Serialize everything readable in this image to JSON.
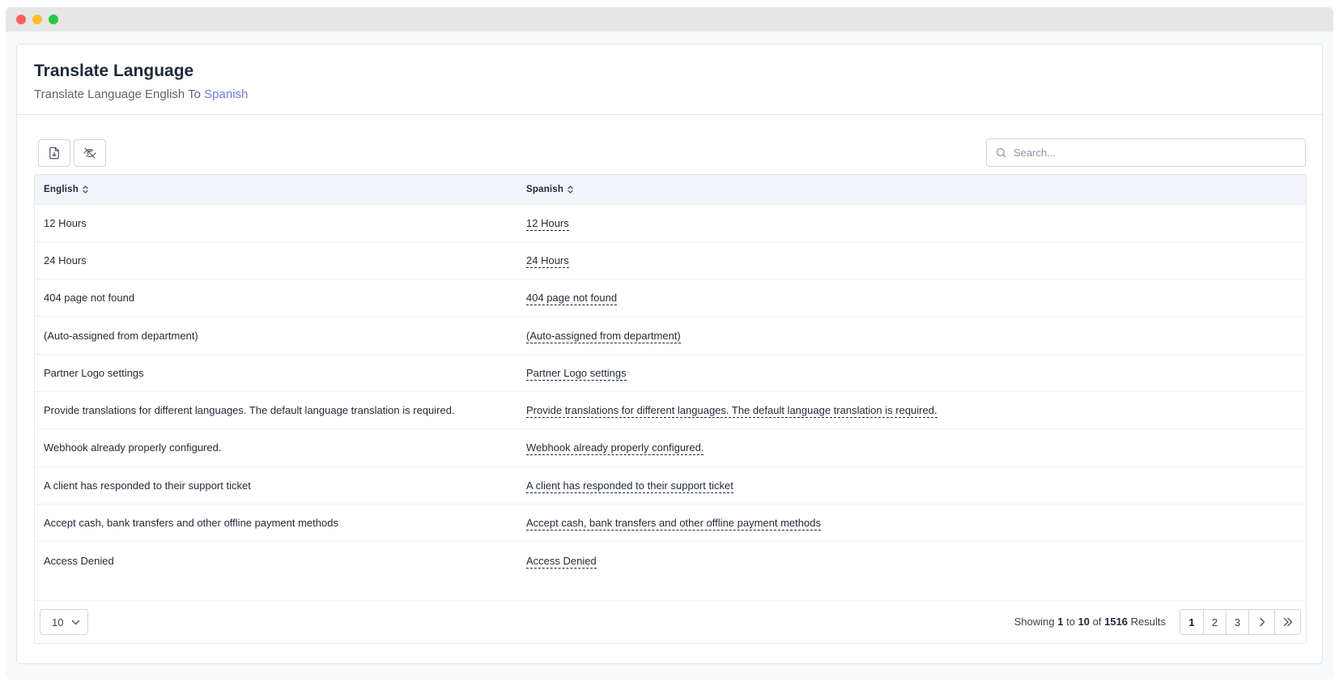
{
  "window": {
    "controls": [
      "close",
      "minimize",
      "maximize"
    ]
  },
  "header": {
    "title": "Translate Language",
    "subtitle_prefix": "Translate Language English To ",
    "subtitle_target": "Spanish"
  },
  "toolbar": {
    "export_icon": "file-download-icon",
    "toggle_icon": "eye-off-icon",
    "search_placeholder": "Search..."
  },
  "table": {
    "columns": [
      "English",
      "Spanish"
    ],
    "rows": [
      {
        "en": "12 Hours",
        "es": "12 Hours"
      },
      {
        "en": "24 Hours",
        "es": "24 Hours"
      },
      {
        "en": "404 page not found",
        "es": "404 page not found"
      },
      {
        "en": "(Auto-assigned from department)",
        "es": "(Auto-assigned from department)"
      },
      {
        "en": "Partner Logo settings",
        "es": "Partner Logo settings"
      },
      {
        "en": "Provide translations for different languages. The default language translation is required.",
        "es": "Provide translations for different languages. The default language translation is required."
      },
      {
        "en": "Webhook already properly configured.",
        "es": "Webhook already properly configured."
      },
      {
        "en": "A client has responded to their support ticket",
        "es": "A client has responded to their support ticket"
      },
      {
        "en": "Accept cash, bank transfers and other offline payment methods",
        "es": "Accept cash, bank transfers and other offline payment methods"
      },
      {
        "en": "Access Denied",
        "es": "Access Denied"
      }
    ]
  },
  "footer": {
    "page_size": "10",
    "showing_prefix": "Showing ",
    "from": "1",
    "to_word": " to ",
    "to": "10",
    "of_word": " of ",
    "total": "1516",
    "results_word": " Results",
    "pages": [
      "1",
      "2",
      "3"
    ],
    "current_page": "1"
  }
}
